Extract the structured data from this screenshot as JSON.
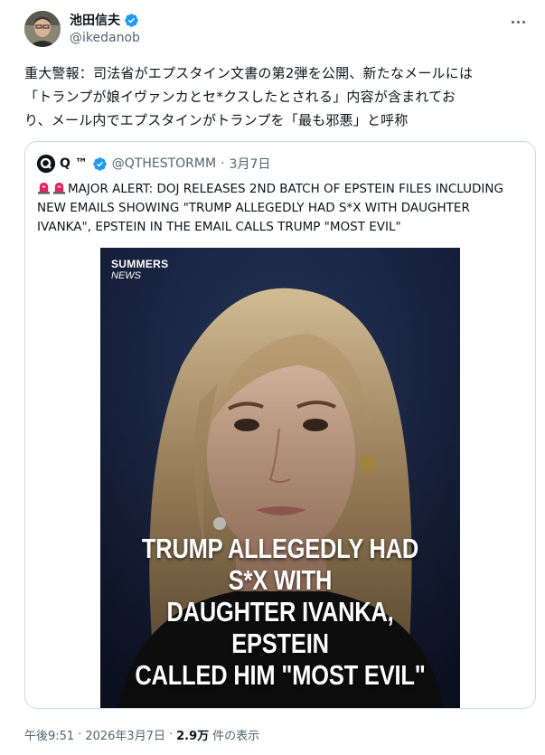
{
  "author": {
    "display_name": "池田信夫",
    "handle": "@ikedanob"
  },
  "tweet": {
    "text_lines": [
      "重大警報：司法省がエプスタイン文書の第2弾を公開、新たなメールには",
      "「トランプが娘イヴァンカとセ*クスしたとされる」内容が含まれてお",
      "り、メール内でエプスタインがトランプを「最も邪悪」と呼称"
    ]
  },
  "quote": {
    "display_name": "Q ™",
    "handle": "@QTHESTORMM",
    "separator": "·",
    "date": "3月7日",
    "text_lines": [
      "MAJOR ALERT: DOJ RELEASES 2ND BATCH OF EPSTEIN FILES INCLUDING",
      "NEW EMAILS SHOWING \"TRUMP ALLEGEDLY HAD S*X WITH DAUGHTER",
      "IVANKA\", EPSTEIN IN THE EMAIL CALLS TRUMP \"MOST EVIL\""
    ],
    "media": {
      "brand_line1": "SUMMERS",
      "brand_line2": "NEWS",
      "caption_lines": [
        "TRUMP ALLEGEDLY HAD S*X WITH",
        "DAUGHTER IVANKA, EPSTEIN",
        "CALLED HIM \"MOST EVIL\""
      ]
    }
  },
  "footer": {
    "time": "午後9:51",
    "separator": "·",
    "date": "2026年3月7日",
    "views_count": "2.9万",
    "views_label": "件の表示"
  },
  "colors": {
    "verified_blue": "#1d9bf0",
    "text_primary": "#0f1419",
    "text_secondary": "#536471",
    "border": "#cfd9de"
  }
}
